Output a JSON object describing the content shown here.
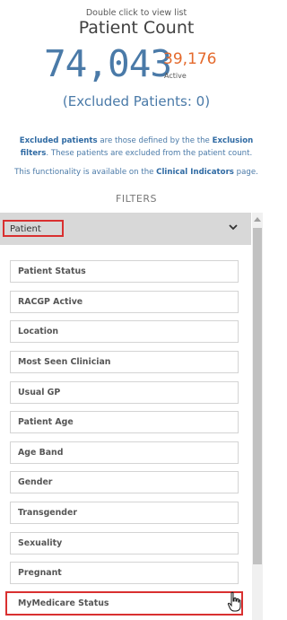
{
  "header": {
    "hint": "Double click to view list",
    "title": "Patient Count",
    "count": "74,043",
    "active_count": "39,176",
    "active_label": "Active",
    "excluded": "(Excluded Patients: 0)"
  },
  "note1": {
    "part1": "Excluded patients",
    "part2": " are those defined by the the ",
    "part3": "Exclusion filters",
    "part4": ". These patients are excluded from the patient count."
  },
  "note2": {
    "part1": "This functionality is available on the ",
    "part2": "Clinical Indicators",
    "part3": " page."
  },
  "filters": {
    "heading": "FILTERS",
    "group_label": "Patient",
    "items": [
      "Patient Status",
      "RACGP Active",
      "Location",
      "Most Seen Clinician",
      "Usual GP",
      "Patient Age",
      "Age Band",
      "Gender",
      "Transgender",
      "Sexuality",
      "Pregnant",
      "MyMedicare Status"
    ]
  },
  "colors": {
    "accent_blue": "#4a7aa8",
    "accent_orange": "#e4692c",
    "highlight_red": "#d93030"
  },
  "icons": {
    "collapse": "chevron-down-icon",
    "scroll_up": "scroll-up-arrow-icon",
    "pointer": "hand-cursor-icon"
  }
}
